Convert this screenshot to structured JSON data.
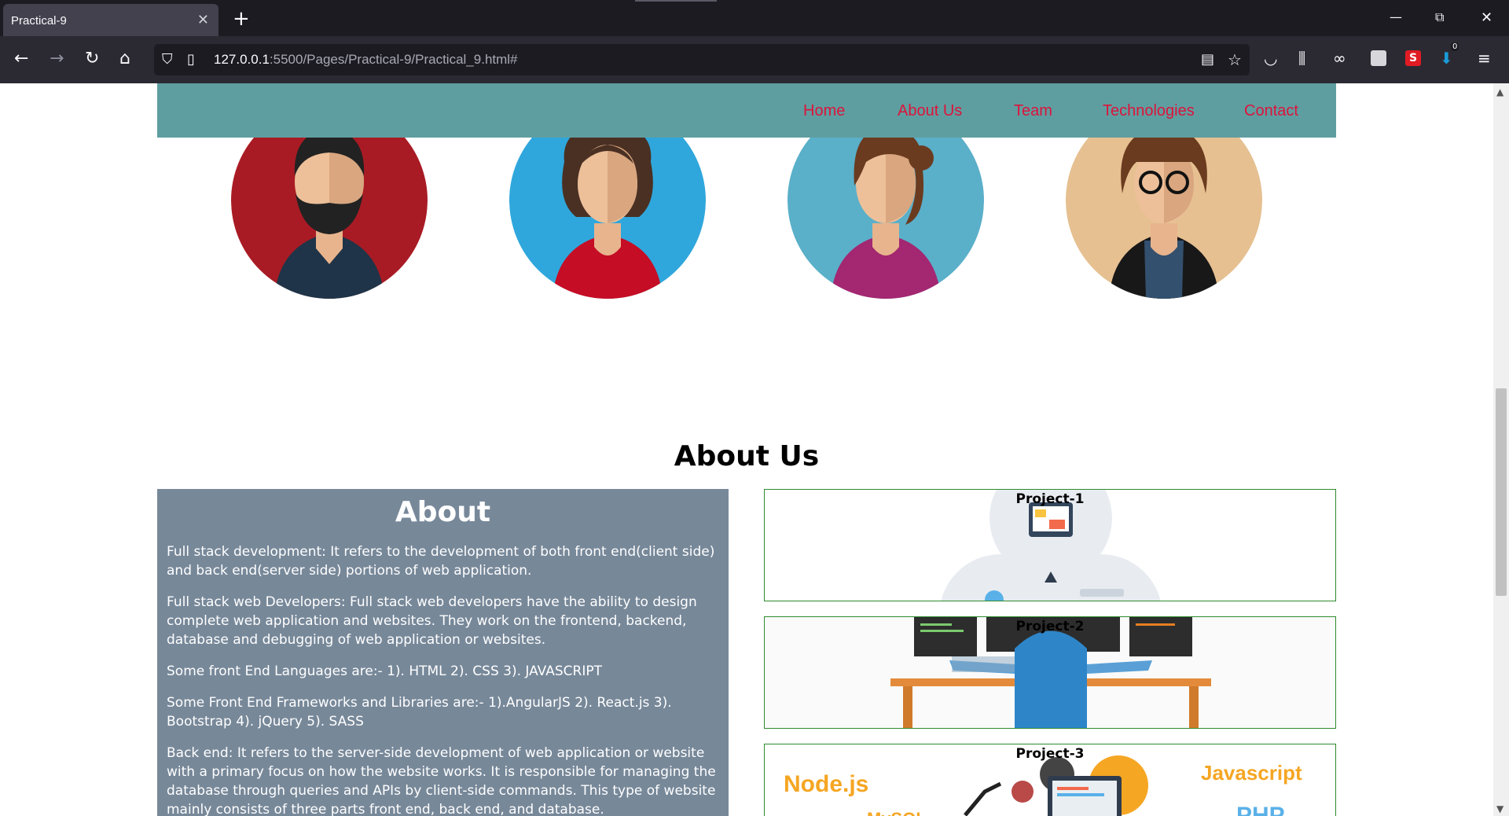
{
  "browser": {
    "tab_title": "Practical-9",
    "url_host": "127.0.0.1",
    "url_rest": ":5500/Pages/Practical-9/Practical_9.html#",
    "extension_badge": "0"
  },
  "nav": {
    "items": [
      "Home",
      "About Us",
      "Team",
      "Technologies",
      "Contact"
    ]
  },
  "about": {
    "section_title": "About Us",
    "heading": "About",
    "paragraphs": [
      "Full stack development: It refers to the development of both front end(client side) and back end(server side) portions of web application.",
      "Full stack web Developers: Full stack web developers have the ability to design complete web application and websites. They work on the frontend, backend, database and debugging of web application or websites.",
      "Some front End Languages are:- 1). HTML 2). CSS 3). JAVASCRIPT",
      "Some Front End Frameworks and Libraries are:- 1).AngularJS 2). React.js 3). Bootstrap 4). jQuery 5). SASS",
      "Back end: It refers to the server-side development of web application or website with a primary focus on how the website works. It is responsible for managing the database through queries and APIs by client-side commands. This type of website mainly consists of three parts front end, back end, and database."
    ]
  },
  "projects": [
    {
      "label": "Project-1"
    },
    {
      "label": "Project-2"
    },
    {
      "label": "Project-3",
      "image_text": [
        "Node.js",
        "Javascript",
        "PHP",
        "MySQL"
      ]
    }
  ],
  "colors": {
    "navbar_bg": "#5f9ea0",
    "nav_link": "#dc143c",
    "about_bg": "#778899",
    "project_border": "#2e8b2e"
  }
}
